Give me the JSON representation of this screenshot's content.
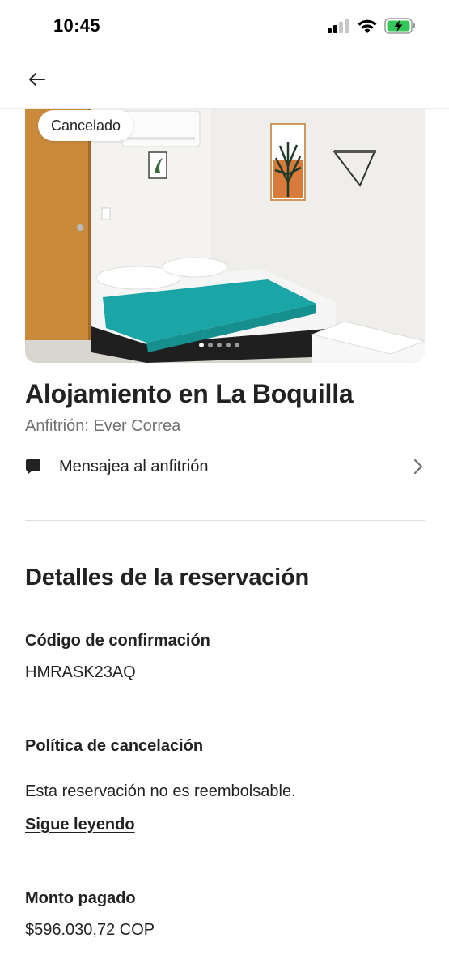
{
  "status_bar": {
    "time": "10:45"
  },
  "listing": {
    "status_badge": "Cancelado",
    "title": "Alojamiento en La Boquilla",
    "host": "Anfitrión: Ever Correa",
    "message_host_label": "Mensajea al anfitrión",
    "photo_count": 5,
    "active_photo_index": 0
  },
  "details": {
    "section_title": "Detalles de la reservación",
    "confirmation_label": "Código de confirmación",
    "confirmation_code": "HMRASK23AQ",
    "cancellation_label": "Política de cancelación",
    "cancellation_text": "Esta reservación no es reembolsable.",
    "read_more_link": "Sigue leyendo",
    "amount_label": "Monto pagado",
    "amount_value": "$596.030,72 COP"
  },
  "icons": {
    "back": "arrow-left-icon",
    "message": "chat-bubble-icon",
    "chevron": "chevron-right-icon",
    "signal": "cellular-signal-icon",
    "wifi": "wifi-icon",
    "battery": "battery-charging-icon"
  },
  "colors": {
    "text_primary": "#222222",
    "text_secondary": "#717171",
    "battery_green": "#34c759",
    "bedspread_teal": "#1aa6a6"
  }
}
